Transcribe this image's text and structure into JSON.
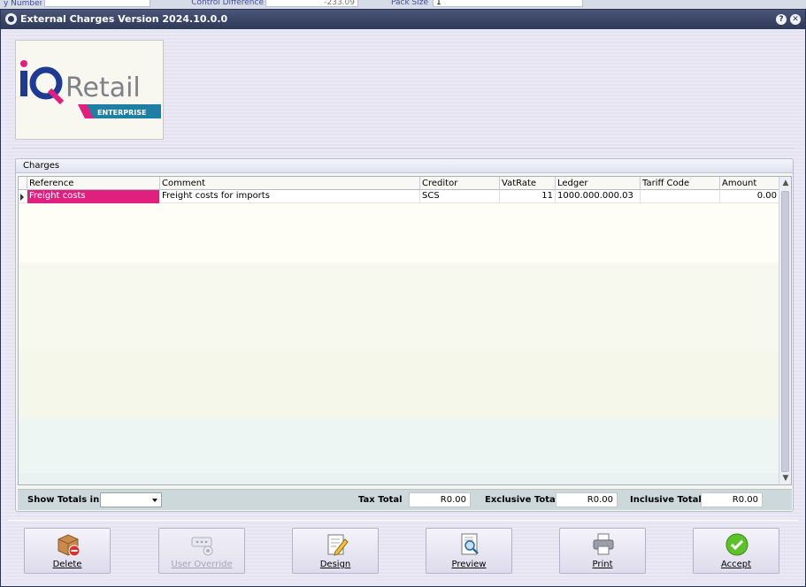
{
  "background_strip": {
    "item1_label": "y Number",
    "item2_label": "Control Difference",
    "item2_value": "-233.09",
    "item3_label": "Pack Size",
    "item3_value": "1"
  },
  "window": {
    "title": "External Charges Version 2024.10.0.0",
    "help_glyph": "?",
    "close_glyph": "✕"
  },
  "logo": {
    "brand_iq": "iQ",
    "brand_retail": "Retail",
    "tagline": "ENTERPRISE",
    "colors": {
      "pink": "#e0207e",
      "navy": "#1f3a93",
      "gray": "#7f8088",
      "teal": "#1e7fa3"
    }
  },
  "charges": {
    "group_title": "Charges",
    "columns": [
      "Reference",
      "Comment",
      "Creditor",
      "VatRate",
      "Ledger",
      "Tariff Code",
      "Amount"
    ],
    "rows": [
      {
        "reference": "Freight costs",
        "comment": "Freight costs for imports",
        "creditor": "SCS",
        "vatrate": "11",
        "ledger": "1000.000.000.03",
        "tariff_code": "",
        "amount": "0.00"
      }
    ],
    "selection_color": "#e0207e"
  },
  "totals": {
    "show_totals_label": "Show Totals in",
    "show_totals_value": "",
    "tax_total_label": "Tax Total",
    "tax_total_value": "R0.00",
    "exclusive_total_label": "Exclusive Total",
    "exclusive_total_value": "R0.00",
    "inclusive_total_label": "Inclusive Total",
    "inclusive_total_value": "R0.00"
  },
  "toolbar": {
    "delete_label": "Delete",
    "user_override_label": "User Override",
    "design_label": "Design",
    "preview_label": "Preview",
    "print_label": "Print",
    "accept_label": "Accept"
  }
}
